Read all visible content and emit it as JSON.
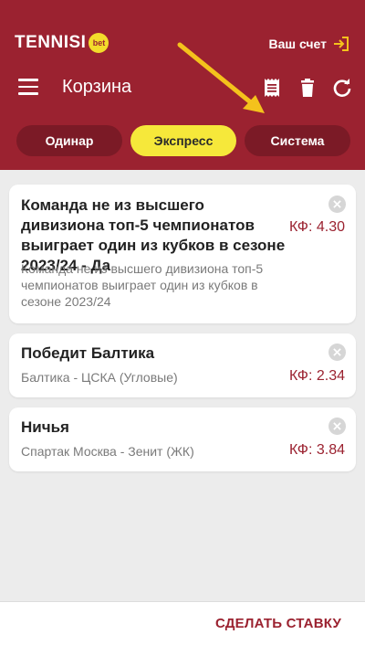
{
  "header": {
    "logo": "TENNISI",
    "logo_badge": "bet",
    "account_label": "Ваш счет",
    "title": "Корзина"
  },
  "tabs": [
    {
      "label": "Одинар",
      "active": false
    },
    {
      "label": "Экспресс",
      "active": true
    },
    {
      "label": "Система",
      "active": false
    }
  ],
  "bets": [
    {
      "title": "Команда не из высшего дивизиона топ-5 чемпионатов выиграет один из кубков в сезоне 2023/24 - Да",
      "event": "Команда не из высшего дивизиона топ-5 чемпионатов выиграет один из кубков в сезоне 2023/24",
      "odds": "КФ: 4.30"
    },
    {
      "title": "Победит Балтика",
      "event": "Балтика - ЦСКА (Угловые)",
      "odds": "КФ: 2.34"
    },
    {
      "title": "Ничья",
      "event": "Спартак Москва - Зенит (ЖК)",
      "odds": "КФ: 3.84"
    }
  ],
  "footer": {
    "bet_button": "СДЕЛАТЬ СТАВКУ"
  },
  "colors": {
    "brand": "#9b2230",
    "active_tab": "#f6e83a",
    "annotation_arrow": "#f4c21c"
  },
  "icons": [
    "hamburger-menu-icon",
    "receipt-icon",
    "trash-icon",
    "refresh-icon",
    "login-icon",
    "close-icon"
  ]
}
